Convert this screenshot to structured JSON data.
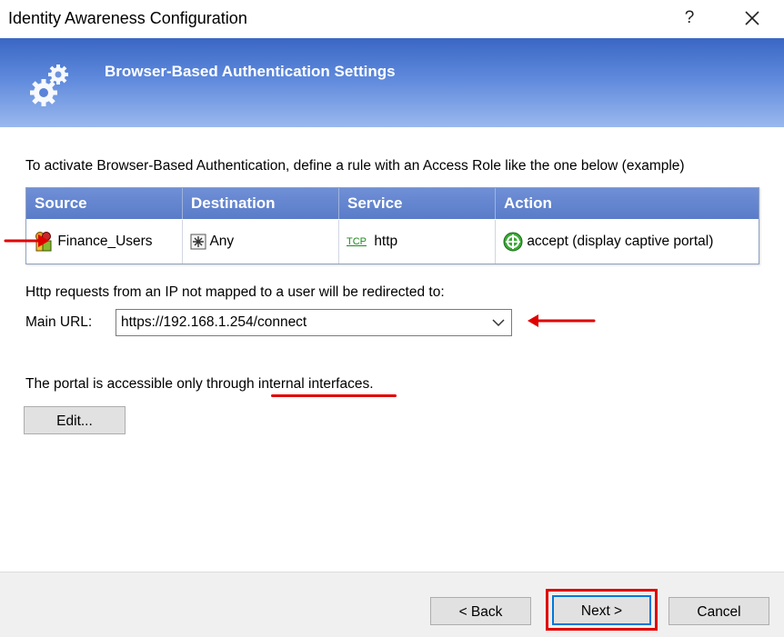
{
  "window": {
    "title": "Identity Awareness Configuration",
    "help_label": "?"
  },
  "banner": {
    "title": "Browser-Based Authentication Settings",
    "icon": "gears-icon"
  },
  "intro_text": "To activate Browser-Based Authentication, define a rule with an Access Role like the one below (example)",
  "rule_table": {
    "headers": [
      "Source",
      "Destination",
      "Service",
      "Action"
    ],
    "row": {
      "source": "Finance_Users",
      "destination": "Any",
      "service_tag": "TCP",
      "service": "http",
      "action": "accept (display captive portal)"
    }
  },
  "redirect_note": "Http requests from an IP not mapped to a user will be redirected to:",
  "main_url": {
    "label": "Main URL:",
    "value": "https://192.168.1.254/connect"
  },
  "portal": {
    "note": "The portal is accessible only through internal interfaces.",
    "edit_label": "Edit..."
  },
  "footer": {
    "back_label": "< Back",
    "next_label": "Next >",
    "cancel_label": "Cancel"
  },
  "colors": {
    "banner": "#5e89dc",
    "table_header": "#6f8fd6",
    "annotation": "#e00000",
    "focus": "#0078d7"
  }
}
